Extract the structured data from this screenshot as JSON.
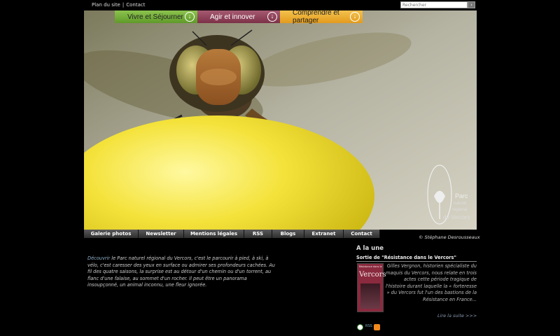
{
  "top_links": {
    "sitemap": "Plan du site",
    "separator": "|",
    "contact": "Contact"
  },
  "search": {
    "placeholder": "Rechercher",
    "button": "›"
  },
  "main_tabs": [
    {
      "label": "Vivre et Séjourner",
      "icon": "arrow-down-circle-icon",
      "color": "#6fae3a"
    },
    {
      "label": "Agir et innover",
      "icon": "arrow-down-circle-icon",
      "color": "#8e3d56"
    },
    {
      "label": "Comprendre et partager",
      "icon": "arrow-down-circle-icon",
      "color": "#ebac34"
    }
  ],
  "hero": {
    "logo_text": [
      "Parc",
      "naturel",
      "régional",
      "du Vercors"
    ]
  },
  "sub_nav": [
    {
      "label": "Galerie photos"
    },
    {
      "label": "Newsletter"
    },
    {
      "label": "Mentions légales"
    },
    {
      "label": "RSS"
    },
    {
      "label": "Blogs"
    },
    {
      "label": "Extranet"
    },
    {
      "label": "Contact"
    }
  ],
  "credit": "© Stéphane Desrousseaux",
  "intro": {
    "highlight": "Découvrir",
    "text": " le Parc naturel régional du Vercors, c'est le parcourir à pied, à ski, à vélo, c'est caresser des yeux en surface ou admirer ses profondeurs cachées. Au fil des quatre saisons, la surprise est au détour d'un chemin ou d'un torrent, au flanc d'une falaise, au sommet d'un rocher. Il peut être un panorama insoupçonné, un animal inconnu, une fleur ignorée."
  },
  "news": {
    "heading": "A la une",
    "title": "Sortie de \"Résistance dans le Vercors\"",
    "book_title": "Vercors",
    "book_series": "Résistance dans le",
    "body": "Gilles Vergnon, historien spécialiste du maquis du Vercors, nous relate en trois actes cette période tragique de l'histoire durant laquelle la « forteresse » du Vercors fut l'un des bastions de la Résistance en France...",
    "more": "Lire la suite >>>"
  },
  "footer_icons": [
    "green-logo-icon",
    "rss-text-icon",
    "rss-feed-icon"
  ],
  "footer_icon_text": "RSS",
  "colors": {
    "accent_green": "#6fae3a",
    "accent_purple": "#8e3d56",
    "accent_orange": "#ebac34",
    "link_blue": "#8fb0c8"
  }
}
